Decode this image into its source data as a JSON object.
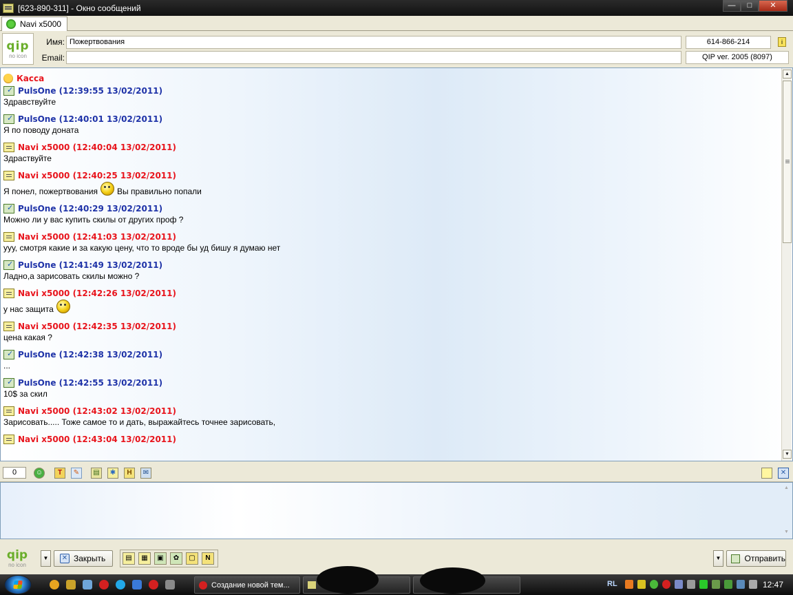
{
  "window": {
    "title": "[623-890-311] - Окно сообщений",
    "buttons": [
      "—",
      "□",
      "✕"
    ]
  },
  "tab": {
    "label": "Navi x5000"
  },
  "contact": {
    "name_label": "Имя:",
    "name_value": "Пожертвования",
    "email_label": "Email:",
    "email_value": "",
    "uin": "614-866-214",
    "client": "QIP ver. 2005 (8097)"
  },
  "logo": {
    "text": "qip",
    "sub": "no icon"
  },
  "chat": {
    "header": "Касса",
    "messages": [
      {
        "sender": "PulsOne (12:39:55 13/02/2011)",
        "dir": "in",
        "text": "Здравствуйте"
      },
      {
        "sender": "PulsOne (12:40:01 13/02/2011)",
        "dir": "in",
        "text": "Я по поводу доната"
      },
      {
        "sender": "Navi x5000 (12:40:04 13/02/2011)",
        "dir": "out",
        "text": "Здраствуйте"
      },
      {
        "sender": "Navi x5000 (12:40:25 13/02/2011)",
        "dir": "out",
        "text": "Я понел, пожертвования",
        "smiley": true,
        "text2": "Вы правильно попали"
      },
      {
        "sender": "PulsOne (12:40:29 13/02/2011)",
        "dir": "in",
        "text": "Можно ли у вас купить скилы от других проф ?"
      },
      {
        "sender": "Navi x5000 (12:41:03 13/02/2011)",
        "dir": "out",
        "text": "ууу, смотря какие и за какую цену, что то вроде бы уд бишу я думаю нет"
      },
      {
        "sender": "PulsOne (12:41:49 13/02/2011)",
        "dir": "in",
        "text": "Ладно,а зарисовать скилы можно ?"
      },
      {
        "sender": "Navi x5000 (12:42:26 13/02/2011)",
        "dir": "out",
        "text": "у нас защита",
        "smiley": true,
        "text2": ""
      },
      {
        "sender": "Navi x5000 (12:42:35 13/02/2011)",
        "dir": "out",
        "text": "цена какая ?"
      },
      {
        "sender": "PulsOne (12:42:38 13/02/2011)",
        "dir": "in",
        "text": "..."
      },
      {
        "sender": "PulsOne (12:42:55 13/02/2011)",
        "dir": "in",
        "text": "10$ за скил"
      },
      {
        "sender": "Navi x5000 (12:43:02 13/02/2011)",
        "dir": "out",
        "text": "Зарисовать..... Тоже самое то и дать, выражайтесь точнее зарисовать,"
      },
      {
        "sender": "Navi x5000 (12:43:04 13/02/2011)",
        "dir": "out",
        "text": ""
      }
    ]
  },
  "toolbar": {
    "counter": "0"
  },
  "input": {
    "value": ""
  },
  "bottom": {
    "close_label": "Закрыть",
    "send_label": "Отправить"
  },
  "taskbar": {
    "task1": "Создание новой тем...",
    "task2": "",
    "task3": "",
    "lang": "RL",
    "clock": "12:47"
  }
}
